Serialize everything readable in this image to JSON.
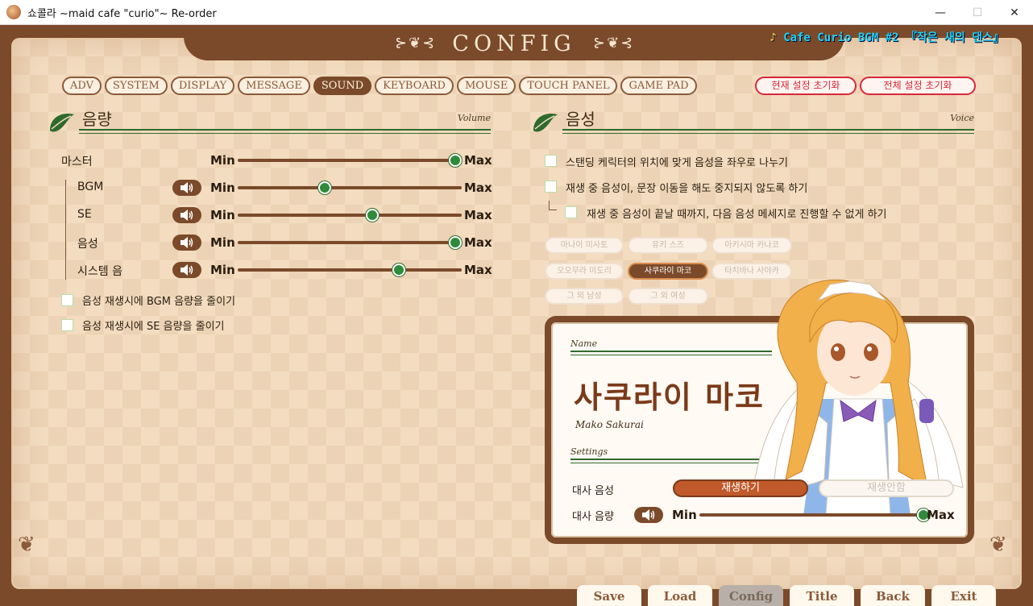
{
  "window": {
    "title": "쇼콜라 ~maid cafe \"curio\"~ Re-order",
    "minimize": "—",
    "maximize": "☐",
    "close": "✕"
  },
  "header": {
    "title": "CONFIG",
    "flourish_left": "⊱❦⊰",
    "flourish_right": "⊱❦⊰",
    "bgm_note": "♪",
    "bgm_text": "Cafe Curio BGM #2 『작은 새의 댄스』"
  },
  "tabs": [
    {
      "label": "ADV"
    },
    {
      "label": "SYSTEM"
    },
    {
      "label": "DISPLAY"
    },
    {
      "label": "MESSAGE"
    },
    {
      "label": "SOUND"
    },
    {
      "label": "KEYBOARD"
    },
    {
      "label": "MOUSE"
    },
    {
      "label": "TOUCH PANEL"
    },
    {
      "label": "GAME PAD"
    }
  ],
  "active_tab": "SOUND",
  "reset": {
    "current": "현재 설정 초기화",
    "all": "전체 설정 초기화"
  },
  "volume": {
    "title": "음량",
    "subtitle": "Volume",
    "min": "Min",
    "max": "Max",
    "rows": [
      {
        "label": "마스터",
        "level": 1.0
      },
      {
        "label": "BGM",
        "level": 0.4
      },
      {
        "label": "SE",
        "level": 0.62
      },
      {
        "label": "음성",
        "level": 1.0
      },
      {
        "label": "시스템 음",
        "level": 0.74
      }
    ],
    "options": [
      {
        "label": "음성 재생시에 BGM 음량을 줄이기",
        "checked": false
      },
      {
        "label": "음성 재생시에 SE 음량을 줄이기",
        "checked": false
      }
    ]
  },
  "voice": {
    "title": "음성",
    "subtitle": "Voice",
    "options": [
      {
        "label": "스탠딩 케릭터의 위치에 맞게 음성을 좌우로 나누기",
        "checked": false
      },
      {
        "label": "재생 중 음성이, 문장 이동을 해도 중지되지 않도록 하기",
        "checked": false
      },
      {
        "label": "재생 중 음성이 끝날 때까지, 다음 음성 메세지로 진행할 수 없게 하기",
        "checked": false
      }
    ],
    "characters": [
      {
        "name": "마나이 미사토"
      },
      {
        "name": "유키 스즈"
      },
      {
        "name": "아키시마 카나코"
      },
      {
        "name": "오오무라 미도리"
      },
      {
        "name": "사쿠라이 마코"
      },
      {
        "name": "타치바나 사야카"
      },
      {
        "name": "그 외 남성"
      },
      {
        "name": "그 외 여성"
      }
    ],
    "selected_character": "사쿠라이 마코"
  },
  "card": {
    "name_label": "Name",
    "name": "사쿠라이 마코",
    "roman": "Mako Sakurai",
    "settings_label": "Settings",
    "dialogue_voice_label": "대사 음성",
    "play_on": "재생하기",
    "play_off": "재생안함",
    "dialogue_volume_label": "대사 음량",
    "min": "Min",
    "max": "Max",
    "dialogue_volume_level": 1.0
  },
  "bottom": [
    {
      "label": "Save"
    },
    {
      "label": "Load"
    },
    {
      "label": "Config"
    },
    {
      "label": "Title"
    },
    {
      "label": "Back"
    },
    {
      "label": "Exit"
    }
  ],
  "colors": {
    "frame": "#7a4a2a",
    "accent_green": "#2f8a3c",
    "reset_red": "#d8283a",
    "bgm_cyan": "#22d3f0"
  }
}
